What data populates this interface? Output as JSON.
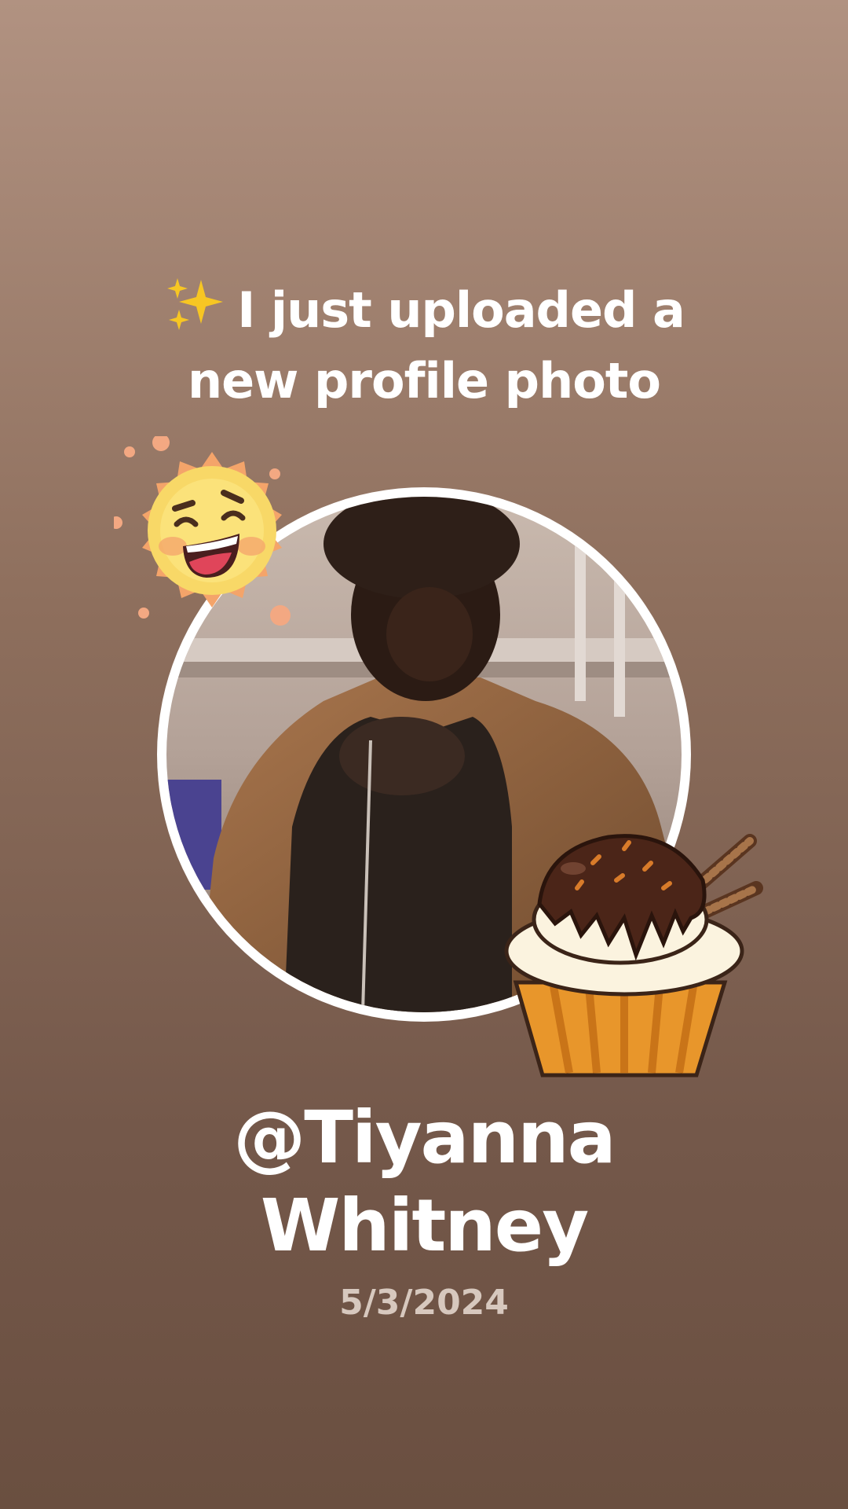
{
  "post": {
    "headline_line1": "I just uploaded a",
    "headline_line2": "new profile photo",
    "username_line1": "@Tiyanna",
    "username_line2": "Whitney",
    "date": "5/3/2024"
  },
  "icons": {
    "headline_emoji": "sparkles-icon",
    "sticker_top_left": "laughing-sun-sticker",
    "sticker_bottom_right": "chocolate-cupcake-sticker"
  },
  "colors": {
    "background_top": "#b19281",
    "background_bottom": "#6a4f40",
    "text_primary": "#ffffff",
    "text_secondary": "#d7c8be",
    "ring": "#ffffff"
  }
}
